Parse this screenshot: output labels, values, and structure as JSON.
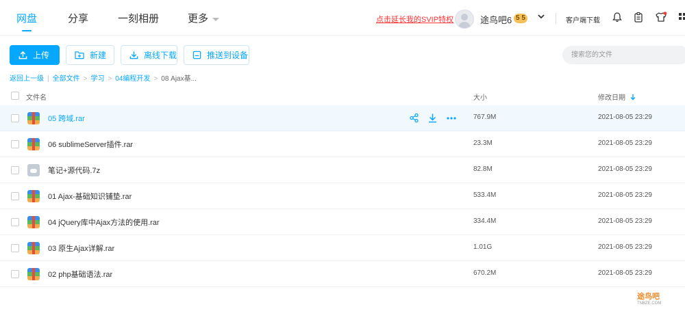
{
  "nav": {
    "items": [
      {
        "label": "网盘"
      },
      {
        "label": "分享"
      },
      {
        "label": "一刻相册"
      },
      {
        "label": "更多"
      }
    ]
  },
  "header": {
    "svip_link": "点击延长我的SVIP特权",
    "username": "途鸟吧6",
    "vip_badge": "5 5",
    "client_download": "客户端下载"
  },
  "toolbar": {
    "upload": "上传",
    "new": "新建",
    "offline": "离线下载",
    "push": "推送到设备"
  },
  "search": {
    "placeholder": "搜索您的文件"
  },
  "breadcrumb": {
    "back": "返回上一级",
    "all": "全部文件",
    "study": "学习",
    "programming": "04编程开发",
    "current": "08 Ajax基..."
  },
  "table": {
    "col_name": "文件名",
    "col_size": "大小",
    "col_date": "修改日期",
    "rows": [
      {
        "name": "05 跨域.rar",
        "size": "767.9M",
        "date": "2021-08-05 23:29",
        "type": "rar"
      },
      {
        "name": "06 sublimeServer插件.rar",
        "size": "23.3M",
        "date": "2021-08-05 23:29",
        "type": "rar"
      },
      {
        "name": "笔记+源代码.7z",
        "size": "82.8M",
        "date": "2021-08-05 23:29",
        "type": "7z"
      },
      {
        "name": "01 Ajax-基础知识铺垫.rar",
        "size": "533.4M",
        "date": "2021-08-05 23:29",
        "type": "rar"
      },
      {
        "name": "04 jQuery库中Ajax方法的使用.rar",
        "size": "334.4M",
        "date": "2021-08-05 23:29",
        "type": "rar"
      },
      {
        "name": "03 原生Ajax详解.rar",
        "size": "1.01G",
        "date": "2021-08-05 23:29",
        "type": "rar"
      },
      {
        "name": "02 php基础语法.rar",
        "size": "670.2M",
        "date": "2021-08-05 23:29",
        "type": "rar"
      }
    ]
  },
  "watermark": {
    "text": "途鸟吧",
    "sub": "TNBZE.COM"
  },
  "colors": {
    "accent": "#06a7ff",
    "svip": "#ff3333"
  }
}
